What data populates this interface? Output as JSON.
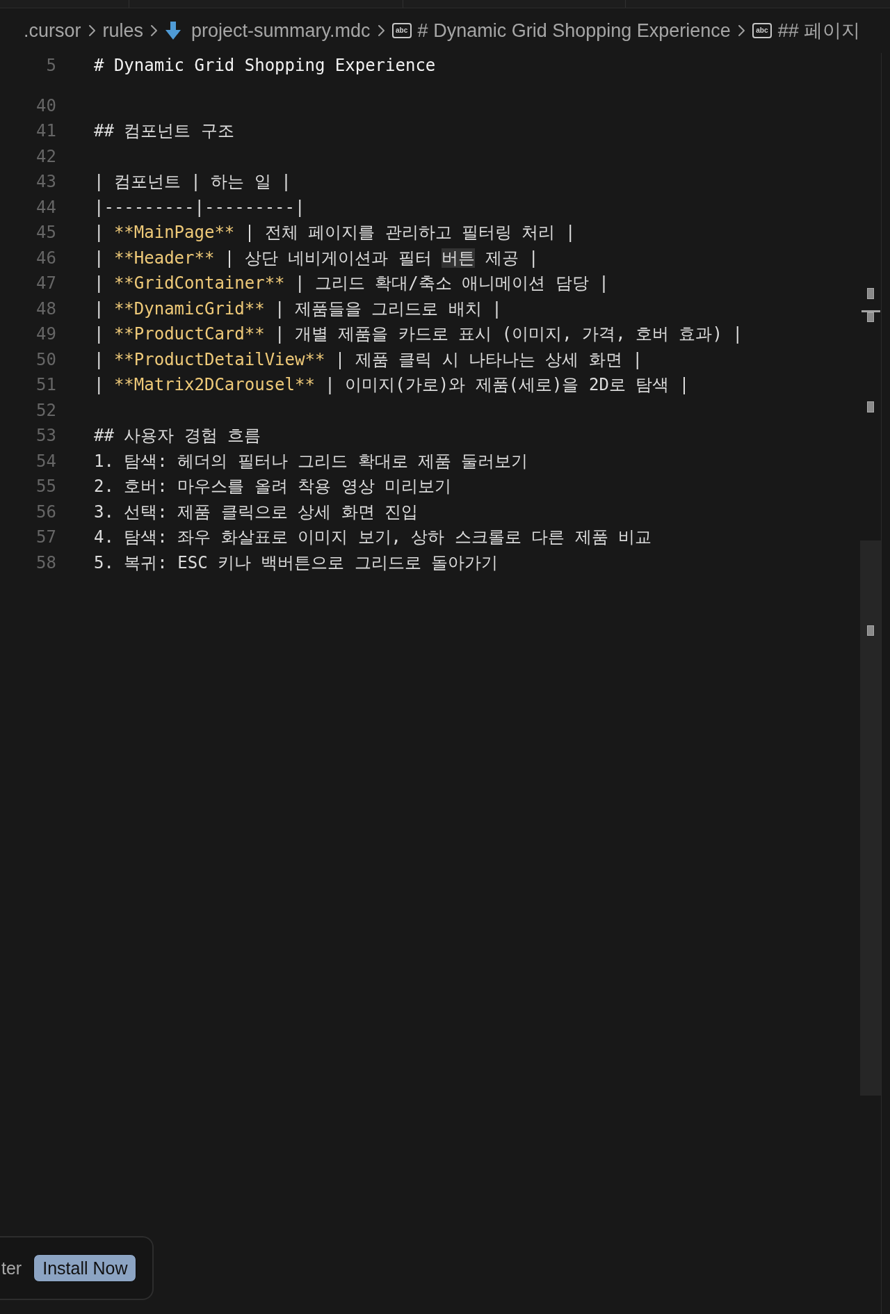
{
  "breadcrumbs": [
    {
      "kind": "folder",
      "label": ".cursor"
    },
    {
      "kind": "folder",
      "label": "rules"
    },
    {
      "kind": "file",
      "label": "project-summary.mdc"
    },
    {
      "kind": "symbol",
      "symbol": "abc",
      "label": "# Dynamic Grid Shopping Experience"
    },
    {
      "kind": "symbol",
      "symbol": "abc",
      "label": "## 페이지"
    }
  ],
  "sticky_scroll": {
    "number": "5",
    "text": "# Dynamic Grid Shopping Experience"
  },
  "lines": [
    {
      "number": "40"
    },
    {
      "number": "41",
      "segments": [
        {
          "kind": "plain",
          "text": "## 컴포넌트 구조"
        }
      ]
    },
    {
      "number": "42"
    },
    {
      "number": "43",
      "segments": [
        {
          "kind": "plain",
          "text": "| 컴포넌트 | 하는 일 |"
        }
      ]
    },
    {
      "number": "44",
      "segments": [
        {
          "kind": "plain",
          "text": "|---------|---------|"
        }
      ]
    },
    {
      "number": "45",
      "segments": [
        {
          "kind": "plain",
          "text": "| "
        },
        {
          "kind": "bold",
          "text": "**MainPage**"
        },
        {
          "kind": "plain",
          "text": " | 전체 페이지를 관리하고 필터링 처리 |"
        }
      ]
    },
    {
      "number": "46",
      "segments": [
        {
          "kind": "plain",
          "text": "| "
        },
        {
          "kind": "bold",
          "text": "**Header**"
        },
        {
          "kind": "plain",
          "text": " | 상단 네비게이션과 필터 "
        },
        {
          "kind": "match",
          "text": "버튼"
        },
        {
          "kind": "plain",
          "text": " 제공 |"
        }
      ]
    },
    {
      "number": "47",
      "segments": [
        {
          "kind": "plain",
          "text": "| "
        },
        {
          "kind": "bold",
          "text": "**GridContainer**"
        },
        {
          "kind": "plain",
          "text": " | 그리드 확대/축소 애니메이션 담당 |"
        }
      ]
    },
    {
      "number": "48",
      "segments": [
        {
          "kind": "plain",
          "text": "| "
        },
        {
          "kind": "bold",
          "text": "**DynamicGrid**"
        },
        {
          "kind": "plain",
          "text": " | 제품들을 그리드로 배치 |"
        }
      ]
    },
    {
      "number": "49",
      "segments": [
        {
          "kind": "plain",
          "text": "| "
        },
        {
          "kind": "bold",
          "text": "**ProductCard**"
        },
        {
          "kind": "plain",
          "text": " | 개별 제품을 카드로 표시 (이미지, 가격, 호버 효과) |"
        }
      ]
    },
    {
      "number": "50",
      "segments": [
        {
          "kind": "plain",
          "text": "| "
        },
        {
          "kind": "bold",
          "text": "**ProductDetailView**"
        },
        {
          "kind": "plain",
          "text": " | 제품 클릭 시 나타나는 상세 화면 |"
        }
      ]
    },
    {
      "number": "51",
      "segments": [
        {
          "kind": "plain",
          "text": "| "
        },
        {
          "kind": "bold",
          "text": "**Matrix2DCarousel**"
        },
        {
          "kind": "plain",
          "text": " | 이미지(가로)와 제품(세로)을 2D로 탐색 |"
        }
      ]
    },
    {
      "number": "52"
    },
    {
      "number": "53",
      "segments": [
        {
          "kind": "plain",
          "text": "## 사용자 경험 흐름"
        }
      ]
    },
    {
      "number": "54",
      "segments": [
        {
          "kind": "plain",
          "text": "1. 탐색: 헤더의 필터나 그리드 확대로 제품 둘러보기"
        }
      ]
    },
    {
      "number": "55",
      "segments": [
        {
          "kind": "plain",
          "text": "2. 호버: 마우스를 올려 착용 영상 미리보기"
        }
      ]
    },
    {
      "number": "56",
      "segments": [
        {
          "kind": "plain",
          "text": "3. 선택: 제품 클릭으로 상세 화면 진입"
        }
      ]
    },
    {
      "number": "57",
      "segments": [
        {
          "kind": "plain",
          "text": "4. 탐색: 좌우 화살표로 이미지 보기, 상하 스크롤로 다른 제품 비교"
        }
      ]
    },
    {
      "number": "58",
      "segments": [
        {
          "kind": "plain",
          "text": "5. 복귀: ESC 키나 백버튼으로 그리드로 돌아가기"
        }
      ]
    }
  ],
  "notification": {
    "text": "ter",
    "button": "Install Now"
  }
}
